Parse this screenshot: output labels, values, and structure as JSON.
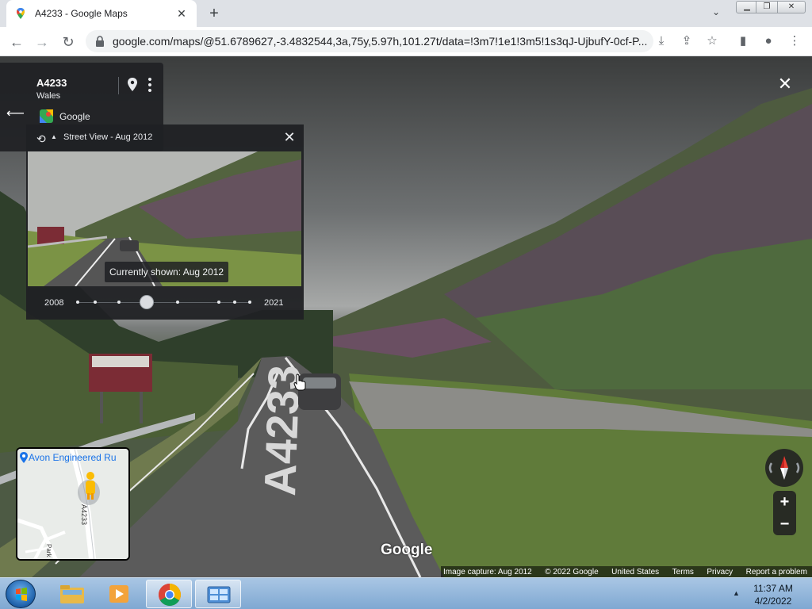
{
  "browser": {
    "tab_title": "A4233 - Google Maps",
    "url": "google.com/maps/@51.6789627,-3.4832544,3a,75y,5.97h,101.27t/data=!3m7!1e1!3m5!1s3qJ-UjbufY-0cf-P...",
    "window_controls": [
      "minimize-icon",
      "maximize-icon",
      "close-icon"
    ]
  },
  "info_card": {
    "title": "A4233",
    "subtitle": "Wales",
    "brand": "Google"
  },
  "timeline": {
    "title": "Street View - Aug 2012",
    "current": "Currently shown: Aug 2012",
    "start_year": "2008",
    "end_year": "2021",
    "selected_fraction": 0.4
  },
  "minimap": {
    "label": "Avon Engineered Ru",
    "road_label": "A4233",
    "street_label": "Park Pl North"
  },
  "watermark": "Google",
  "footer": {
    "capture": "Image capture: Aug 2012",
    "copyright": "© 2022 Google",
    "region": "United States",
    "terms": "Terms",
    "privacy": "Privacy",
    "report": "Report a problem"
  },
  "taskbar": {
    "time": "11:37 AM",
    "date": "4/2/2022"
  }
}
